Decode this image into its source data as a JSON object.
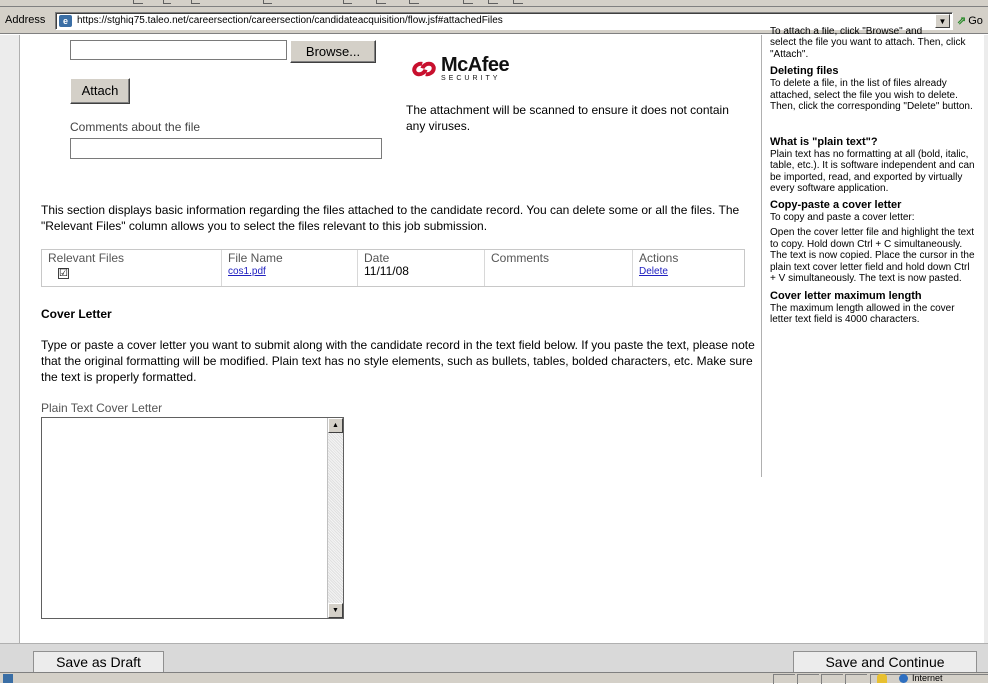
{
  "browser": {
    "address_label": "Address",
    "url": "https://stghiq75.taleo.net/careersection/careersection/candidateacquisition/flow.jsf#attachedFiles",
    "go_label": "Go",
    "zone_label": "Internet"
  },
  "upload": {
    "browse_label": "Browse...",
    "attach_label": "Attach",
    "comments_label": "Comments about the file",
    "scan_text": "The attachment will be scanned to ensure it does not contain any viruses."
  },
  "mcafee": {
    "word": "McAfee",
    "sub": "SECURITY"
  },
  "files": {
    "intro": "This section displays basic information regarding the files attached to the candidate record. You can delete some or all the files. The \"Relevant Files\" column allows you to select the files relevant to this job submission.",
    "headers": {
      "relevant": "Relevant Files",
      "name": "File Name",
      "date": "Date",
      "comments": "Comments",
      "actions": "Actions"
    },
    "rows": [
      {
        "checked": "☑",
        "name": "cos1.pdf",
        "date": "11/11/08",
        "comments": "",
        "action": "Delete"
      }
    ]
  },
  "cover": {
    "title": "Cover Letter",
    "instructions": "Type or paste a cover letter you want to submit along with the candidate record in the text field below. If you paste the text, please note that the original formatting will be modified. Plain text has no style elements, such as bullets, tables, bolded characters, etc. Make sure the text is properly formatted.",
    "field_label": "Plain Text Cover Letter",
    "value": ""
  },
  "help": {
    "cut_top": "To attach a file, click \"Browse\" and",
    "attach_text": "select the file you want to attach. Then, click \"Attach\".",
    "deleting_title": "Deleting files",
    "deleting_text": "To delete a file, in the list of files already attached, select the file you wish to delete. Then, click the corresponding \"Delete\" button.",
    "plain_title": "What is \"plain text\"?",
    "plain_text": "Plain text has no formatting at all (bold, italic, table, etc.). It is software independent and can be imported, read, and exported by virtually every software application.",
    "copy_title": "Copy-paste a cover letter",
    "copy_intro": "To copy and paste a cover letter:",
    "copy_text": "Open the cover letter file and highlight the text to copy. Hold down Ctrl + C simultaneously. The text is now copied. Place the cursor in the plain text cover letter field and hold down Ctrl + V simultaneously. The text is now pasted.",
    "max_title": "Cover letter maximum length",
    "max_text": "The maximum length allowed in the cover letter text field is 4000 characters."
  },
  "actions": {
    "save_draft": "Save as Draft",
    "save_continue": "Save and Continue"
  }
}
